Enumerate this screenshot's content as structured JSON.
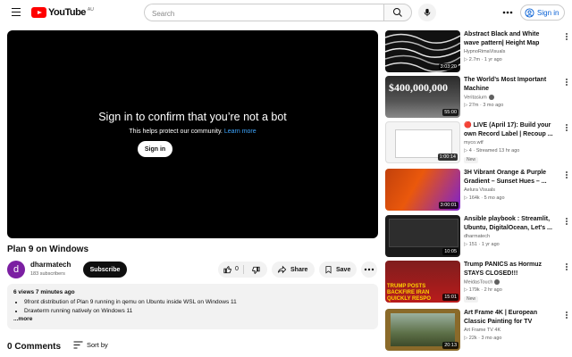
{
  "header": {
    "logo_text": "YouTube",
    "region": "AU",
    "search_placeholder": "Search",
    "signin_label": "Sign in"
  },
  "player": {
    "title": "Sign in to confirm that you’re not a bot",
    "subtitle": "This helps protect our community.",
    "learn_more": "Learn more",
    "signin_button": "Sign in"
  },
  "video": {
    "title": "Plan 9 on Windows",
    "channel_initial": "d",
    "channel_name": "dharmatech",
    "subscribers": "183 subscribers",
    "subscribe_label": "Subscribe",
    "like_count": "0",
    "share_label": "Share",
    "save_label": "Save"
  },
  "description": {
    "meta": "6 views  7 minutes ago",
    "lines": [
      "9front distribution of Plan 9 running in qemu on Ubuntu inside WSL on Windows 11",
      "Drawterm running natively on Windows 11"
    ],
    "more_label": "...more"
  },
  "comments": {
    "count_label": "0 Comments",
    "sort_label": "Sort by"
  },
  "recommendations": [
    {
      "title": "Abstract Black and White wave pattern| Height Map Footage| ...",
      "channel": "HypnoRimaVisuals",
      "meta": "▷ 2.7m · 1 yr ago",
      "duration": "3:03:20",
      "thumb_color": "#111111",
      "verified": false,
      "badge": ""
    },
    {
      "title": "The World’s Most Important Machine",
      "channel": "Veritasium",
      "meta": "▷ 27m · 3 mo ago",
      "duration": "55:00",
      "thumb_color": "#2a2a2a",
      "verified": true,
      "badge": "",
      "thumb_text": "$400,000,000"
    },
    {
      "title": "🔴 LIVE (April 17): Build your own Record Label | Recoup ...",
      "channel": "myco.wtf",
      "meta": "▷ 4 · Streamed 13 hr ago",
      "duration": "1:00:14",
      "thumb_color": "#f4f4f4",
      "verified": false,
      "badge": "New"
    },
    {
      "title": "3H Vibrant Orange & Purple Gradient – Sunset Hues – ...",
      "channel": "Aelura Visuals",
      "meta": "▷ 164k · 5 mo ago",
      "duration": "3:00:01",
      "thumb_color": "#c2410c",
      "verified": false,
      "badge": ""
    },
    {
      "title": "Ansible playbook : Streamlit, Ubuntu, DigitalOcean, Let's ...",
      "channel": "dharmatech",
      "meta": "▷ 151 · 1 yr ago",
      "duration": "10:05",
      "thumb_color": "#1b1b1b",
      "verified": false,
      "badge": ""
    },
    {
      "title": "Trump PANICS as Hormuz STAYS CLOSED!!!",
      "channel": "MeidasTouch",
      "meta": "▷ 179k · 2 hr ago",
      "duration": "15:01",
      "thumb_color": "#7f1d1d",
      "verified": true,
      "badge": "New",
      "thumb_text": "TRUMP POSTS BACKFIRE IRAN QUICKLY RESPO"
    },
    {
      "title": "Art Frame 4K | European Classic Painting for TV",
      "channel": "Art Frame TV 4K",
      "meta": "▷ 22k · 3 mo ago",
      "duration": "20:13",
      "thumb_color": "#8a6a2a",
      "verified": false,
      "badge": ""
    }
  ]
}
